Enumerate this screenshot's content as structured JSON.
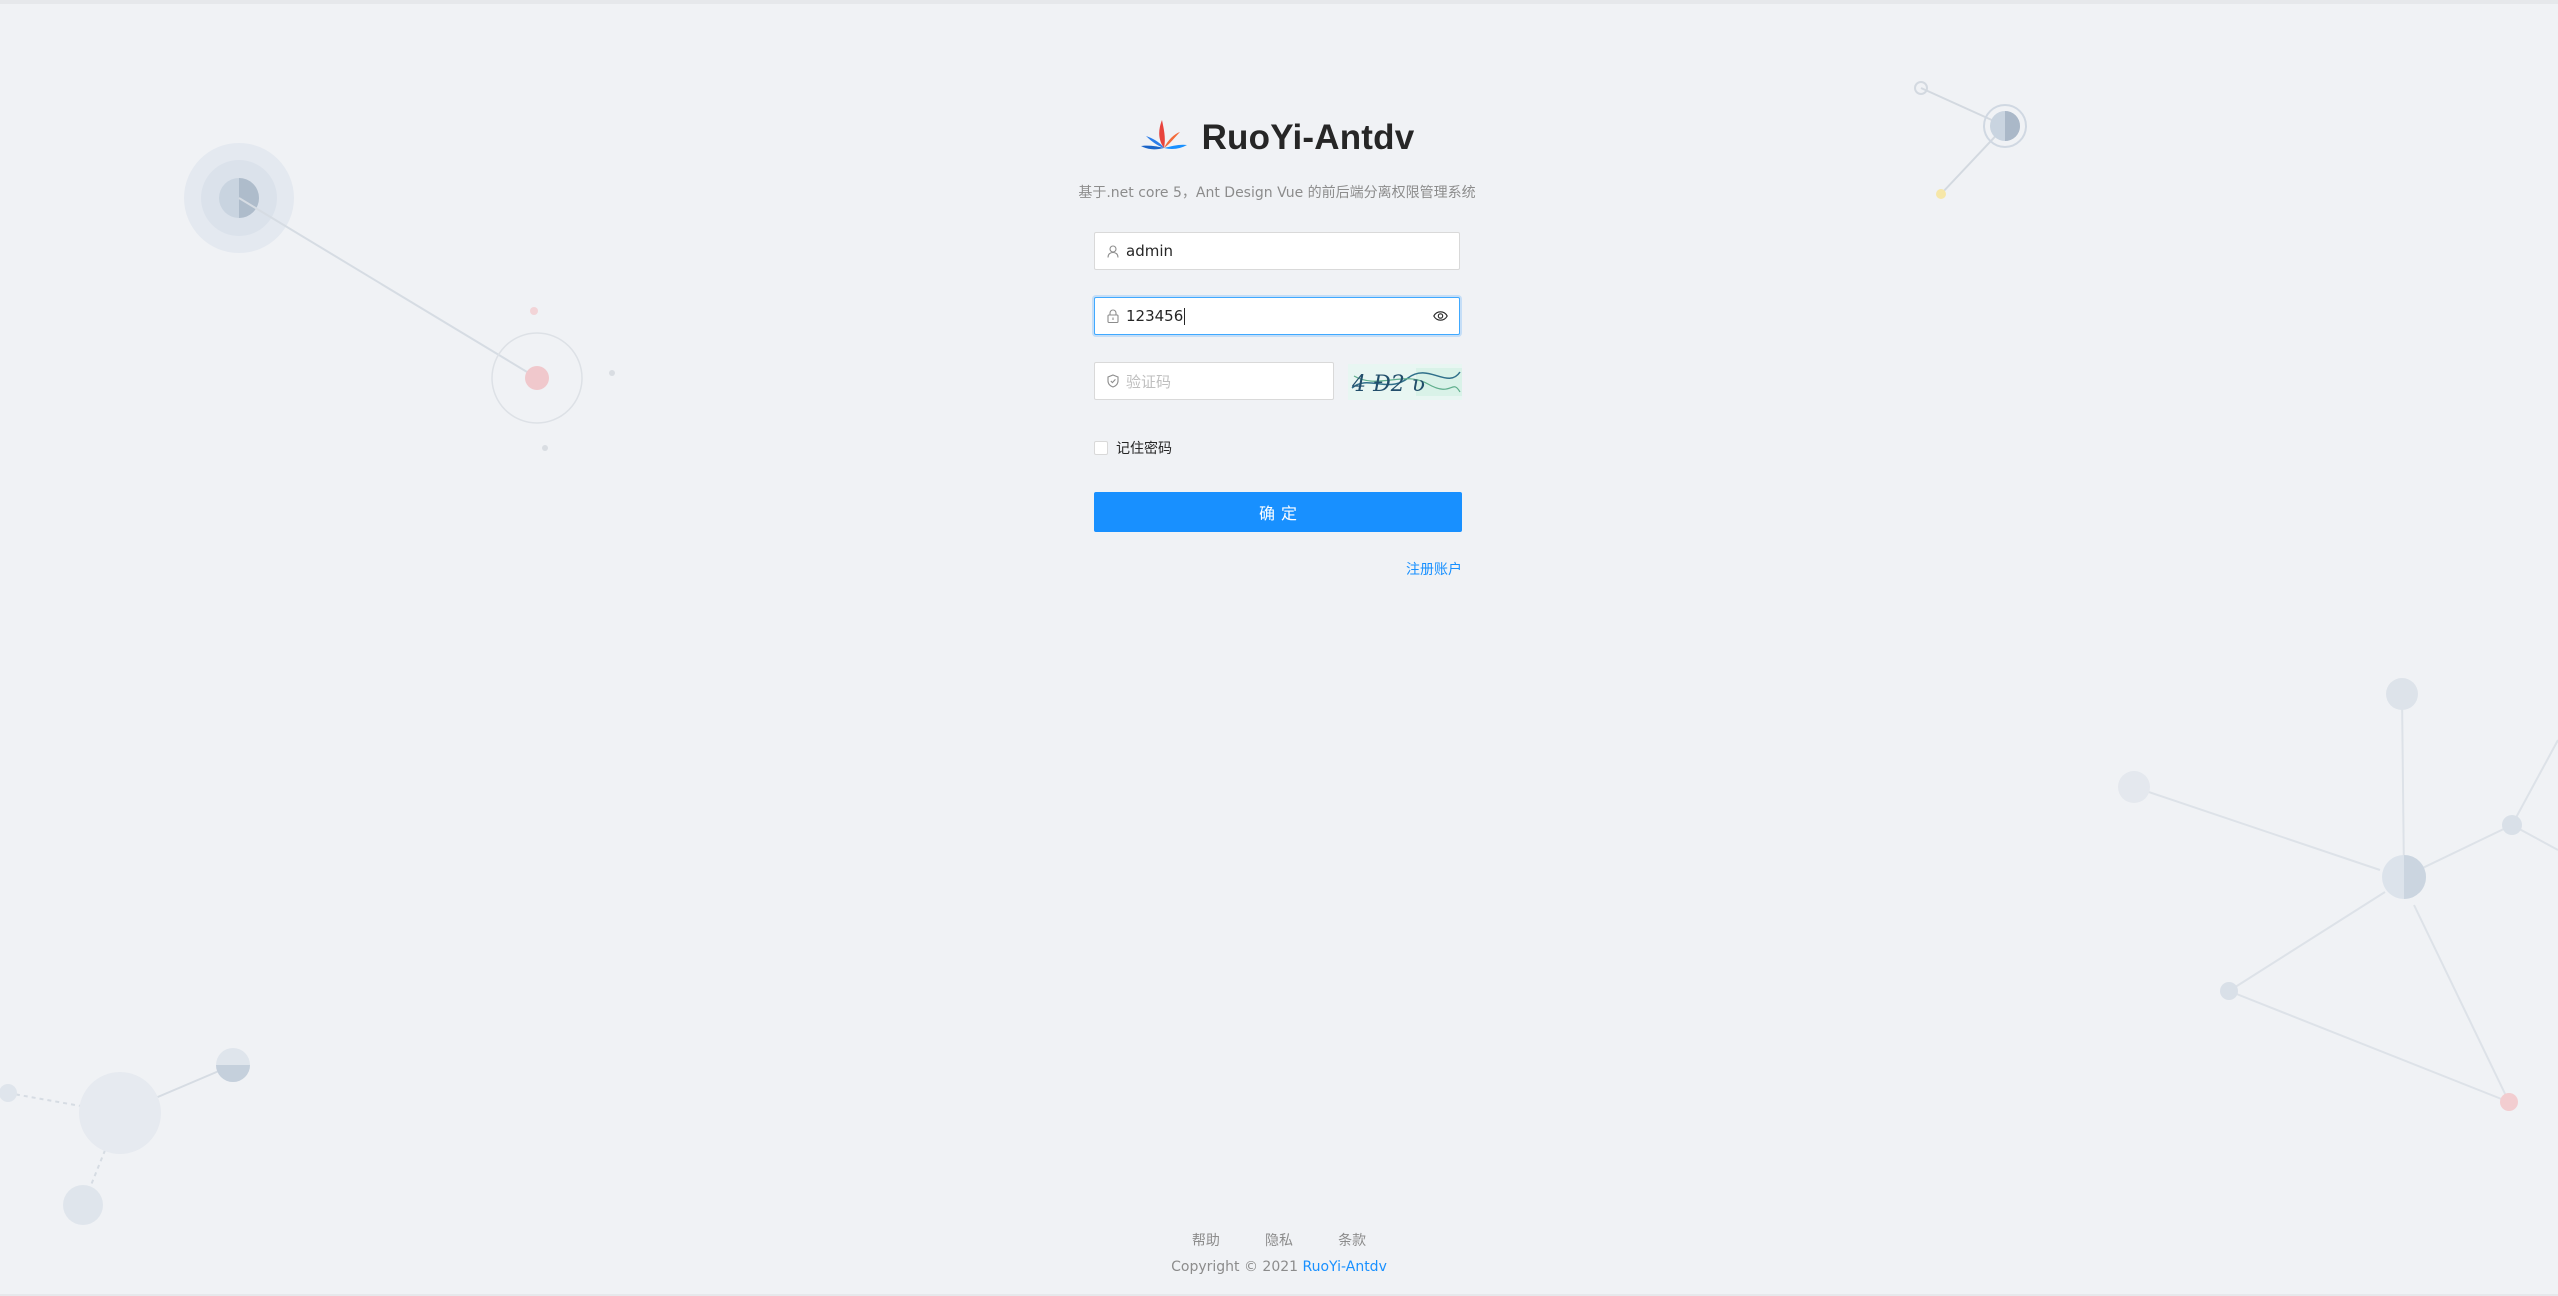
{
  "app": {
    "title": "RuoYi-Antdv",
    "subtitle": "基于.net core 5，Ant Design Vue 的前后端分离权限管理系统"
  },
  "form": {
    "username": {
      "value": "admin",
      "icon": "user-icon"
    },
    "password": {
      "value": "123456",
      "icon": "lock-icon",
      "visibility_icon": "eye-icon"
    },
    "captcha": {
      "placeholder": "验证码",
      "icon": "safety-icon",
      "image_text": "4 Ð2 ʋ"
    },
    "remember_label": "记住密码",
    "remember_checked": false,
    "submit_label": "确定",
    "register_label": "注册账户"
  },
  "footer": {
    "links": [
      "帮助",
      "隐私",
      "条款"
    ],
    "copyright_prefix": "Copyright © 2021",
    "copyright_brand": "RuoYi-Antdv"
  },
  "colors": {
    "primary": "#1890ff",
    "background": "#f0f2f5"
  }
}
